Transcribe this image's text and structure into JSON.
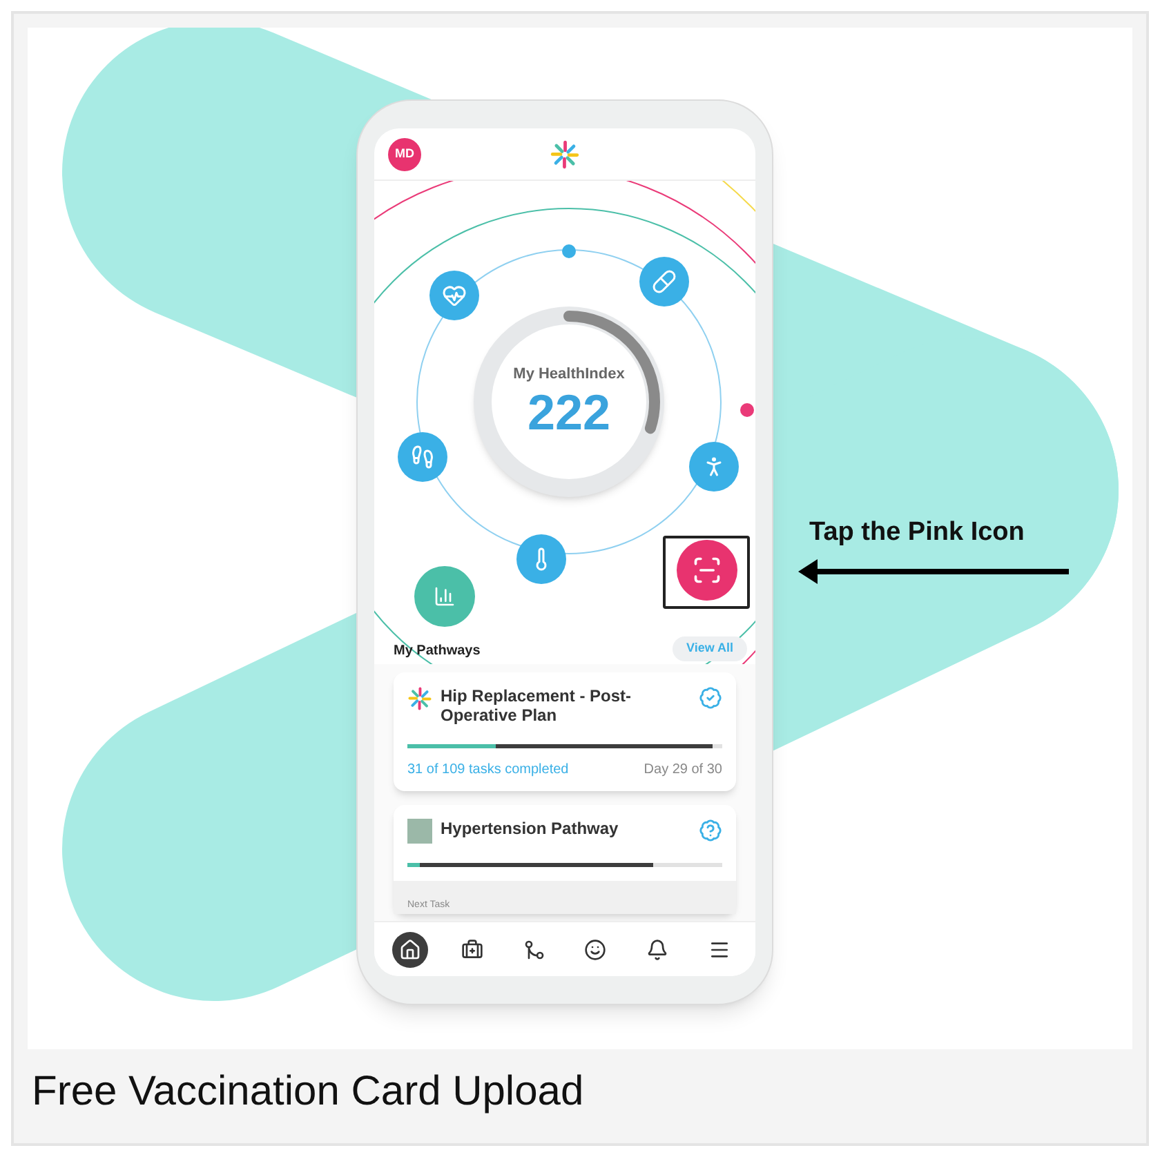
{
  "header": {
    "avatar_initials": "MD"
  },
  "health_index": {
    "label": "My HealthIndex",
    "value": "222",
    "level": 0.3
  },
  "pathways": {
    "title": "My Pathways",
    "view_all": "View All",
    "cards": [
      {
        "title": "Hip Replacement - Post-Operative Plan",
        "kind": "check",
        "tasks": {
          "level": 0.28
        },
        "days": {
          "level": 0.97
        },
        "tasks_text": "31 of 109 tasks completed",
        "day_text": "Day 29 of 30"
      },
      {
        "title": "Hypertension Pathway",
        "kind": "question",
        "tasks": {
          "level": 0.04
        },
        "days": {
          "level": 0.78
        },
        "next_label": "Next Task"
      }
    ]
  },
  "bottom_nav": [
    {
      "selected": true
    },
    {
      "selected": false
    },
    {
      "selected": false
    },
    {
      "selected": false
    },
    {
      "selected": false
    },
    {
      "selected": false
    }
  ],
  "callout": {
    "text": "Tap the Pink Icon"
  },
  "caption": "Free Vaccination Card Upload"
}
